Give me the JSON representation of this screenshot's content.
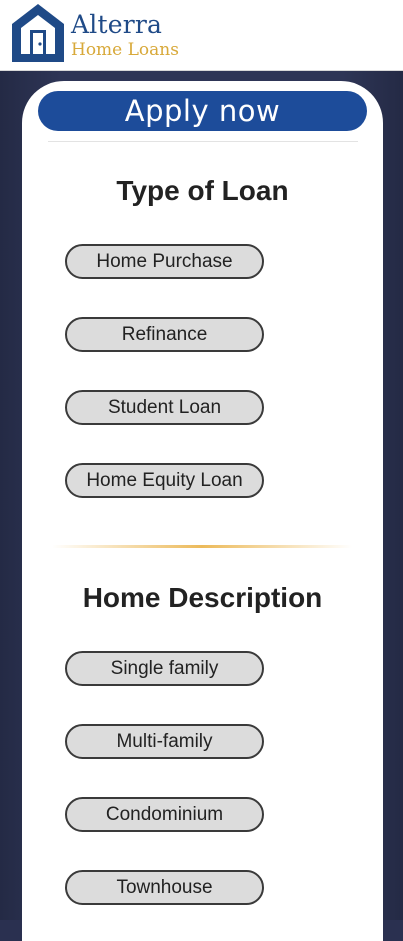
{
  "brand": {
    "name_top": "Alterra",
    "name_bottom": "Home Loans",
    "primary_color": "#1f4a87",
    "accent_color": "#d8a93a"
  },
  "apply": {
    "label": "Apply now"
  },
  "loan_type": {
    "title": "Type of Loan",
    "options": [
      "Home Purchase",
      "Refinance",
      "Student Loan",
      "Home Equity Loan"
    ]
  },
  "home_description": {
    "title": "Home Description",
    "options": [
      "Single family",
      "Multi-family",
      "Condominium",
      "Townhouse"
    ]
  }
}
